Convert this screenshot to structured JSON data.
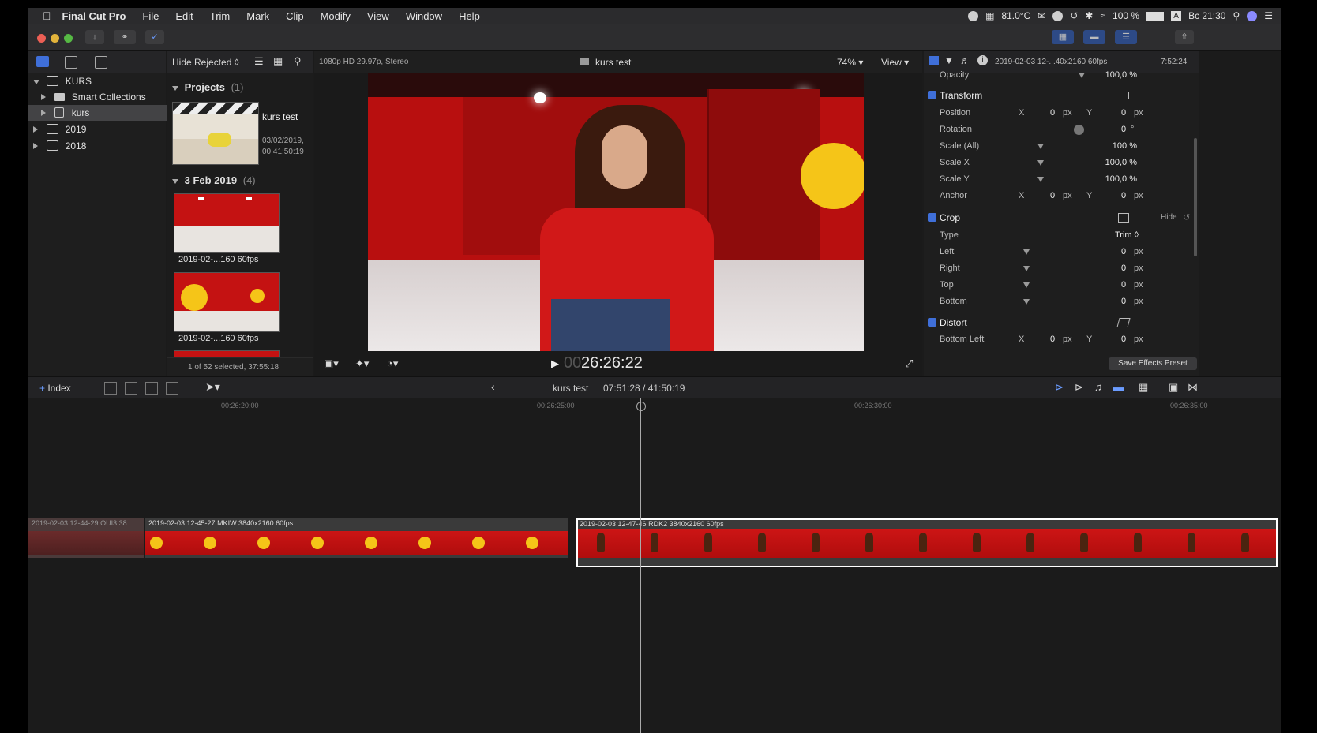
{
  "menu": {
    "app_name": "Final Cut Pro",
    "items": [
      "File",
      "Edit",
      "Trim",
      "Mark",
      "Clip",
      "Modify",
      "View",
      "Window",
      "Help"
    ]
  },
  "status": {
    "temperature": "81.0°C",
    "battery": "100 %",
    "time": "Вс 21:30"
  },
  "library": {
    "filter": "Hide Rejected ◊",
    "rows": [
      {
        "label": "KURS",
        "kind": "library"
      },
      {
        "label": "Smart Collections",
        "kind": "folder"
      },
      {
        "label": "kurs",
        "kind": "event",
        "selected": true
      },
      {
        "label": "2019",
        "kind": "library"
      },
      {
        "label": "2018",
        "kind": "library"
      }
    ]
  },
  "browser": {
    "projects_header": "Projects",
    "projects_count": "(1)",
    "project": {
      "name": "kurs test",
      "date": "03/02/2019,",
      "duration": "00:41:50:19"
    },
    "date_header": "3 Feb 2019",
    "date_count": "(4)",
    "clips": [
      {
        "name": "2019-02-...160 60fps"
      },
      {
        "name": "2019-02-...160 60fps"
      }
    ],
    "footer": "1 of 52 selected, 37:55:18"
  },
  "viewer": {
    "format": "1080p HD 29.97p, Stereo",
    "title": "kurs test",
    "zoom": "74%",
    "view_menu": "View",
    "timecode_prefix": "00",
    "timecode": "26:26:22"
  },
  "inspector": {
    "clip_name": "2019-02-03 12-...40x2160 60fps",
    "duration": "7:52:24",
    "opacity": {
      "label": "Opacity",
      "value": "100,0 %"
    },
    "transform": {
      "title": "Transform",
      "rows": [
        {
          "label": "Position",
          "x": "0",
          "y": "0",
          "unit": "px"
        },
        {
          "label": "Rotation",
          "value": "0",
          "unit": "°"
        },
        {
          "label": "Scale (All)",
          "value": "100 %"
        },
        {
          "label": "Scale X",
          "value": "100,0 %"
        },
        {
          "label": "Scale Y",
          "value": "100,0 %"
        },
        {
          "label": "Anchor",
          "x": "0",
          "y": "0",
          "unit": "px"
        }
      ]
    },
    "crop": {
      "title": "Crop",
      "hide": "Hide",
      "type_label": "Type",
      "type_value": "Trim ◊",
      "rows": [
        {
          "label": "Left",
          "value": "0",
          "unit": "px"
        },
        {
          "label": "Right",
          "value": "0",
          "unit": "px"
        },
        {
          "label": "Top",
          "value": "0",
          "unit": "px"
        },
        {
          "label": "Bottom",
          "value": "0",
          "unit": "px"
        }
      ]
    },
    "distort": {
      "title": "Distort",
      "row": {
        "label": "Bottom Left",
        "x": "0",
        "y": "0",
        "unit": "px"
      }
    },
    "x_label": "X",
    "y_label": "Y",
    "save_preset": "Save Effects Preset"
  },
  "timeline": {
    "index": "Index",
    "project": "kurs test",
    "position": "07:51:28 / 41:50:19",
    "ruler": [
      "00:26:20:00",
      "00:26:25:00",
      "00:26:30:00",
      "00:26:35:00"
    ],
    "clips": [
      {
        "name": "2019-02-03 12-44-29 OUI3 38"
      },
      {
        "name": "2019-02-03 12-45-27 MKIW 3840x2160 60fps"
      },
      {
        "name": "2019-02-03 12-47-46 RDK2 3840x2160 60fps"
      }
    ]
  },
  "colors": {
    "accent": "#3f6fd9",
    "clip_red": "#c41212",
    "badge_yellow": "#f5c518",
    "selection": "#ffffff"
  }
}
